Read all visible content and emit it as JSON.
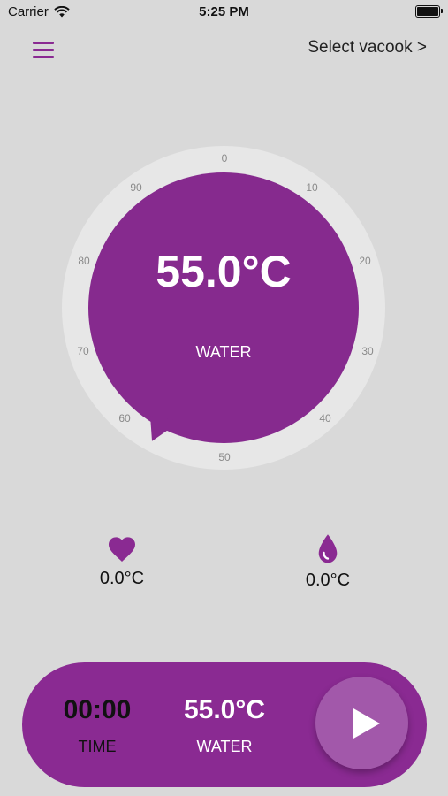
{
  "status_bar": {
    "carrier": "Carrier",
    "time": "5:25 PM"
  },
  "header": {
    "select_device": "Select vacook >"
  },
  "dial": {
    "ticks": [
      "0",
      "10",
      "20",
      "30",
      "40",
      "50",
      "60",
      "70",
      "80",
      "90"
    ],
    "temperature": "55.0°C",
    "mode": "WATER"
  },
  "sensors": {
    "core": {
      "icon": "heart-icon",
      "value": "0.0°C"
    },
    "water": {
      "icon": "water-drop-icon",
      "value": "0.0°C"
    }
  },
  "control_bar": {
    "time_value": "00:00",
    "time_label": "TIME",
    "temp_value": "55.0°C",
    "temp_label": "WATER",
    "play_icon": "play-icon"
  },
  "colors": {
    "accent": "#862a8e",
    "background": "#d9d9d9",
    "ring": "#e7e7e7"
  }
}
